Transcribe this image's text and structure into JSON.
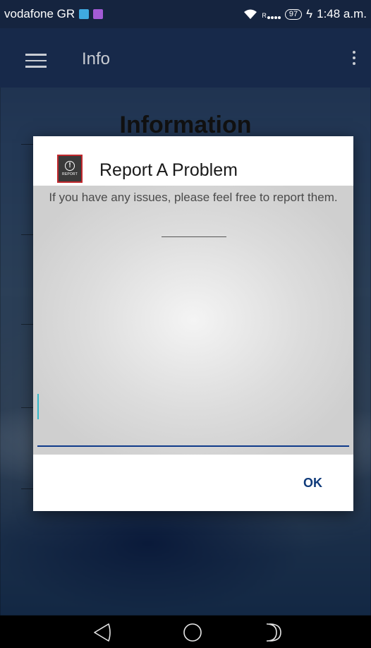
{
  "status_bar": {
    "carrier": "vodafone GR",
    "signal_roaming": "R",
    "battery": "97",
    "time": "1:48 a.m."
  },
  "app_bar": {
    "title": "Info",
    "menu_icon": "hamburger-menu-icon",
    "overflow_icon": "overflow-menu-icon"
  },
  "page": {
    "heading": "Information"
  },
  "dialog": {
    "icon_label": "REPORT",
    "title": "Report A Problem",
    "message": "If you have any issues, please feel free to report them.",
    "input_value": "",
    "ok_label": "OK"
  },
  "nav_bar": {
    "back_icon": "back-icon",
    "home_icon": "home-icon",
    "recents_icon": "recents-icon"
  },
  "colors": {
    "accent": "#0f3a8a",
    "ok_text": "#0f3a7a",
    "cursor": "#31b6c8",
    "report_border": "#c0282d"
  }
}
